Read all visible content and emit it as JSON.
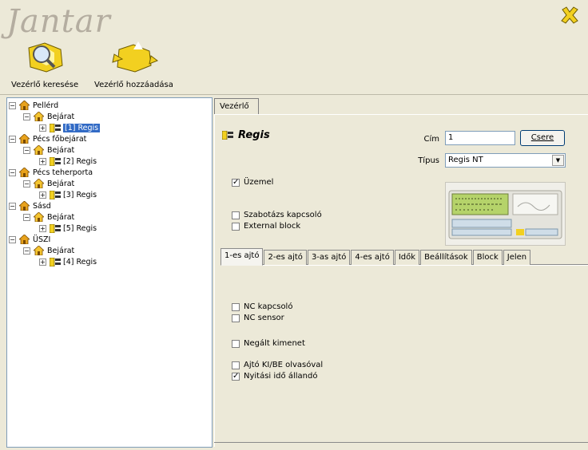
{
  "app": {
    "logo_text": "Jantar"
  },
  "toolbar": {
    "search_label": "Vezérlő keresése",
    "add_label": "Vezérlő hozzáadása"
  },
  "tree": {
    "nodes": [
      {
        "label": "Pellérd"
      },
      {
        "label": "Bejárat"
      },
      {
        "label": "[1] Regis"
      },
      {
        "label": "Pécs főbejárat"
      },
      {
        "label": "Bejárat"
      },
      {
        "label": "[2] Regis"
      },
      {
        "label": "Pécs teherporta"
      },
      {
        "label": "Bejárat"
      },
      {
        "label": "[3] Regis"
      },
      {
        "label": "Sásd"
      },
      {
        "label": "Bejárat"
      },
      {
        "label": "[5] Regis"
      },
      {
        "label": "ÜSZI"
      },
      {
        "label": "Bejárat"
      },
      {
        "label": "[4] Regis"
      }
    ]
  },
  "main_tab": {
    "label": "Vezérlő"
  },
  "controller": {
    "title": "Regis",
    "cim_label": "Cím",
    "cim_value": "1",
    "csere_label": "Csere",
    "tipus_label": "Típus",
    "tipus_value": "Regis NT"
  },
  "checkboxes_top": [
    {
      "label": "Üzemel",
      "checked": true
    },
    {
      "label": "Szabotázs kapcsoló",
      "checked": false
    },
    {
      "label": "External block",
      "checked": false
    }
  ],
  "subtabs": [
    "1-es ajtó",
    "2-es ajtó",
    "3-as ajtó",
    "4-es ajtó",
    "Idők",
    "Beállítások",
    "Block",
    "Jelen"
  ],
  "checkboxes_door": [
    {
      "label": "NC kapcsoló",
      "checked": false
    },
    {
      "label": "NC sensor",
      "checked": false
    },
    {
      "label": "Negált kimenet",
      "checked": false
    },
    {
      "label": "Ajtó KI/BE olvasóval",
      "checked": false
    },
    {
      "label": "Nyitási idő állandó",
      "checked": true
    }
  ],
  "colors": {
    "selection": "#316ac5",
    "house": "#e8a21c",
    "background": "#ece9d8"
  }
}
